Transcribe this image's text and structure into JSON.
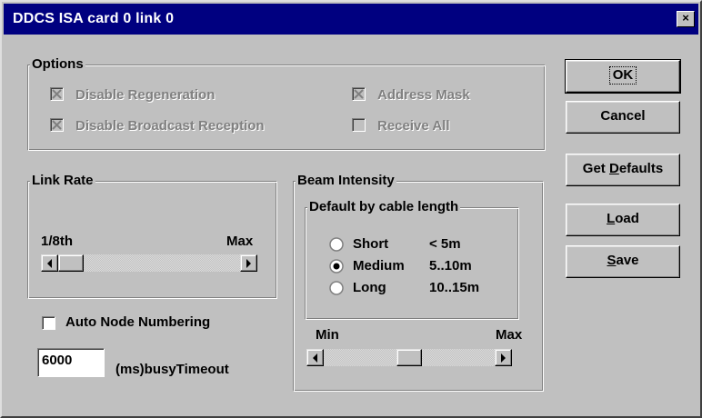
{
  "window": {
    "title": "DDCS ISA card 0 link 0",
    "close_label": "×"
  },
  "options": {
    "legend": "Options",
    "disable_regeneration": {
      "label": "Disable Regeneration",
      "checked": true,
      "enabled": false
    },
    "address_mask": {
      "label": "Address Mask",
      "checked": true,
      "enabled": false
    },
    "disable_broadcast": {
      "label": "Disable Broadcast Reception",
      "checked": true,
      "enabled": false
    },
    "receive_all": {
      "label": "Receive All",
      "checked": false,
      "enabled": false
    }
  },
  "link_rate": {
    "legend": "Link Rate",
    "min_label": "1/8th",
    "max_label": "Max",
    "value": 0.0
  },
  "auto_node": {
    "label": "Auto Node Numbering",
    "checked": false
  },
  "busy_timeout": {
    "value": "6000",
    "label": "(ms)busyTimeout"
  },
  "beam": {
    "legend": "Beam Intensity",
    "cable_legend": "Default by cable length",
    "options": [
      {
        "name": "Short",
        "range": "< 5m",
        "selected": false
      },
      {
        "name": "Medium",
        "range": "5..10m",
        "selected": true
      },
      {
        "name": "Long",
        "range": "10..15m",
        "selected": false
      }
    ],
    "min_label": "Min",
    "max_label": "Max",
    "value": 0.5
  },
  "buttons": {
    "ok": "OK",
    "cancel": "Cancel",
    "get_defaults_pre": "Get ",
    "get_defaults_key": "D",
    "get_defaults_post": "efaults",
    "load_key": "L",
    "load_post": "oad",
    "save_key": "S",
    "save_post": "ave"
  }
}
